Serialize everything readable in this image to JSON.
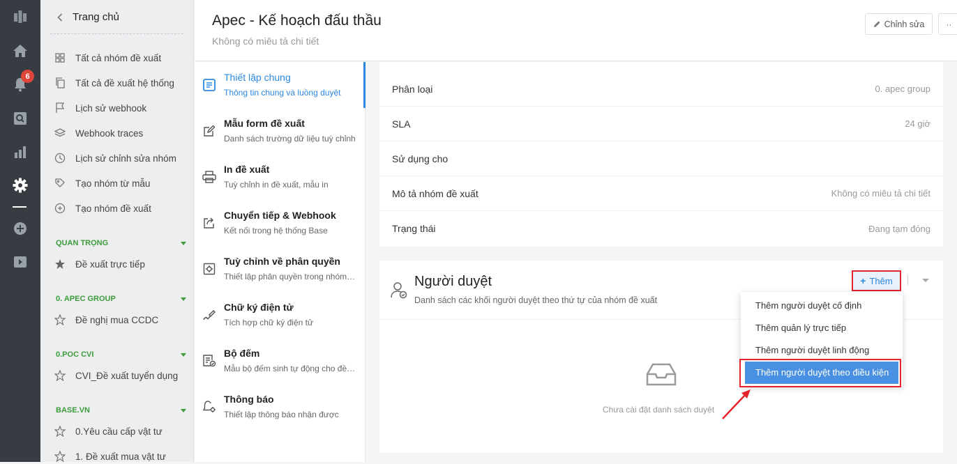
{
  "rail": {
    "notification_count": "6"
  },
  "sidebar": {
    "back_label": "Trang chủ",
    "items": [
      {
        "label": "Tất cả nhóm đề xuất",
        "icon": "grid-icon"
      },
      {
        "label": "Tất cả đề xuất hệ thống",
        "icon": "copy-icon"
      },
      {
        "label": "Lịch sử webhook",
        "icon": "flag-icon"
      },
      {
        "label": "Webhook traces",
        "icon": "layers-icon"
      },
      {
        "label": "Lịch sử chỉnh sửa nhóm",
        "icon": "clock-icon"
      },
      {
        "label": "Tạo nhóm từ mẫu",
        "icon": "tag-icon"
      },
      {
        "label": "Tạo nhóm đề xuất",
        "icon": "plus-circle-icon"
      }
    ],
    "sections": [
      {
        "title": "QUAN TRỌNG",
        "items": [
          "Đề xuất trực tiếp"
        ]
      },
      {
        "title": "0. APEC GROUP",
        "items": [
          "Đề nghị mua CCDC"
        ]
      },
      {
        "title": "0.POC CVI",
        "items": [
          "CVI_Đề xuất tuyển dụng"
        ]
      },
      {
        "title": "BASE.VN",
        "items": [
          "0.Yêu cầu cấp vật tư",
          "1. Đề xuất mua vật tư"
        ]
      }
    ]
  },
  "header": {
    "title": "Apec - Kế hoạch đấu thầu",
    "subtitle": "Không có miêu tả chi tiết",
    "edit_label": "Chỉnh sửa",
    "more_label": "··"
  },
  "nav": [
    {
      "title": "Thiết lập chung",
      "desc": "Thông tin chung và luồng duyệt",
      "icon": "document-icon"
    },
    {
      "title": "Mẫu form đề xuất",
      "desc": "Danh sách trường dữ liệu tuỳ chỉnh",
      "icon": "edit-form-icon"
    },
    {
      "title": "In đề xuất",
      "desc": "Tuỳ chỉnh in đề xuất, mẫu in",
      "icon": "printer-icon"
    },
    {
      "title": "Chuyển tiếp & Webhook",
      "desc": "Kết nối trong hệ thống Base",
      "icon": "share-icon"
    },
    {
      "title": "Tuỳ chỉnh về phân quyền",
      "desc": "Thiết lập phân quyền trong nhóm đề xuất",
      "icon": "permission-gear-icon"
    },
    {
      "title": "Chữ ký điện tử",
      "desc": "Tích hợp chữ ký điện tử",
      "icon": "signature-icon"
    },
    {
      "title": "Bộ đếm",
      "desc": "Mẫu bộ đếm sinh tự động cho đề xuất",
      "icon": "counter-icon"
    },
    {
      "title": "Thông báo",
      "desc": "Thiết lập thông báo nhận được",
      "icon": "bell-gear-icon"
    }
  ],
  "info": [
    {
      "key": "Phân loại",
      "value": "0. apec group"
    },
    {
      "key": "SLA",
      "value": "24 giờ"
    },
    {
      "key": "Sử dụng cho",
      "value": ""
    },
    {
      "key": "Mô tả nhóm đề xuất",
      "value": "Không có miêu tả chi tiết"
    },
    {
      "key": "Trạng thái",
      "value": "Đang tạm đóng"
    }
  ],
  "approvers": {
    "title": "Người duyệt",
    "subtitle": "Danh sách các khối người duyệt theo thứ tự của nhóm đề xuất",
    "add_label": "Thêm",
    "empty_text": "Chưa cài đặt danh sách duyệt",
    "dropdown": [
      "Thêm người duyệt cố định",
      "Thêm quản lý trực tiếp",
      "Thêm người duyệt linh động",
      "Thêm người duyệt theo điều kiện"
    ]
  },
  "colors": {
    "accent": "#2d88e0",
    "highlight": "#4a90e2",
    "annotation": "#e3232d",
    "section": "#3e9b3a",
    "rail": "#373c43"
  }
}
